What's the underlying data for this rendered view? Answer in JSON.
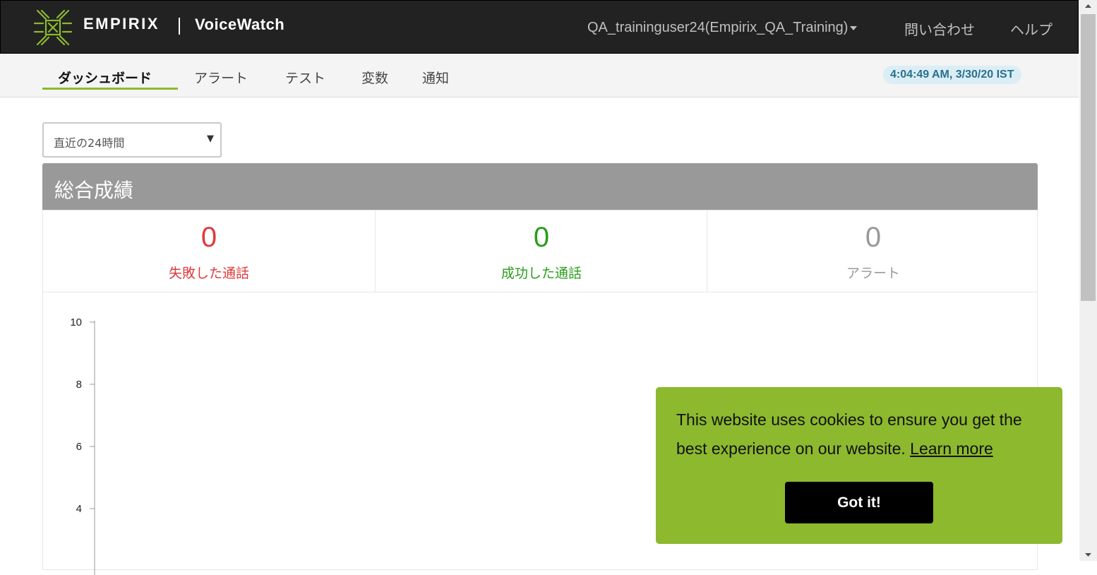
{
  "header": {
    "brand": "EMPIRIX",
    "product": "VoiceWatch",
    "user_menu": "QA_traininguser24(Empirix_QA_Training)",
    "contact": "問い合わせ",
    "help": "ヘルプ"
  },
  "nav": {
    "tabs": [
      {
        "label": "ダッシュボード",
        "active": true
      },
      {
        "label": "アラート"
      },
      {
        "label": "テスト"
      },
      {
        "label": "変数"
      },
      {
        "label": "通知"
      }
    ],
    "clock": "4:04:49 AM, 3/30/20 IST"
  },
  "filter": {
    "range_value": "直近の24時間"
  },
  "panel": {
    "title": "総合成績",
    "stats": [
      {
        "value": "0",
        "label": "失敗した通話",
        "color": "#e0393a"
      },
      {
        "value": "0",
        "label": "成功した通話",
        "color": "#2a9d1b"
      },
      {
        "value": "0",
        "label": "アラート",
        "color": "#999999"
      }
    ]
  },
  "chart_data": {
    "type": "line",
    "title": "",
    "xlabel": "",
    "ylabel": "",
    "y_ticks": [
      "10",
      "8",
      "6",
      "4"
    ],
    "ylim": [
      0,
      10
    ],
    "series": []
  },
  "cookie": {
    "message": "This website uses cookies to ensure you get the best experience on our website.",
    "learn_more": "Learn more",
    "accept_button": "Got it!"
  },
  "colors": {
    "accent_green": "#8db92e",
    "header_bg": "#222222",
    "panel_header": "#999999"
  }
}
